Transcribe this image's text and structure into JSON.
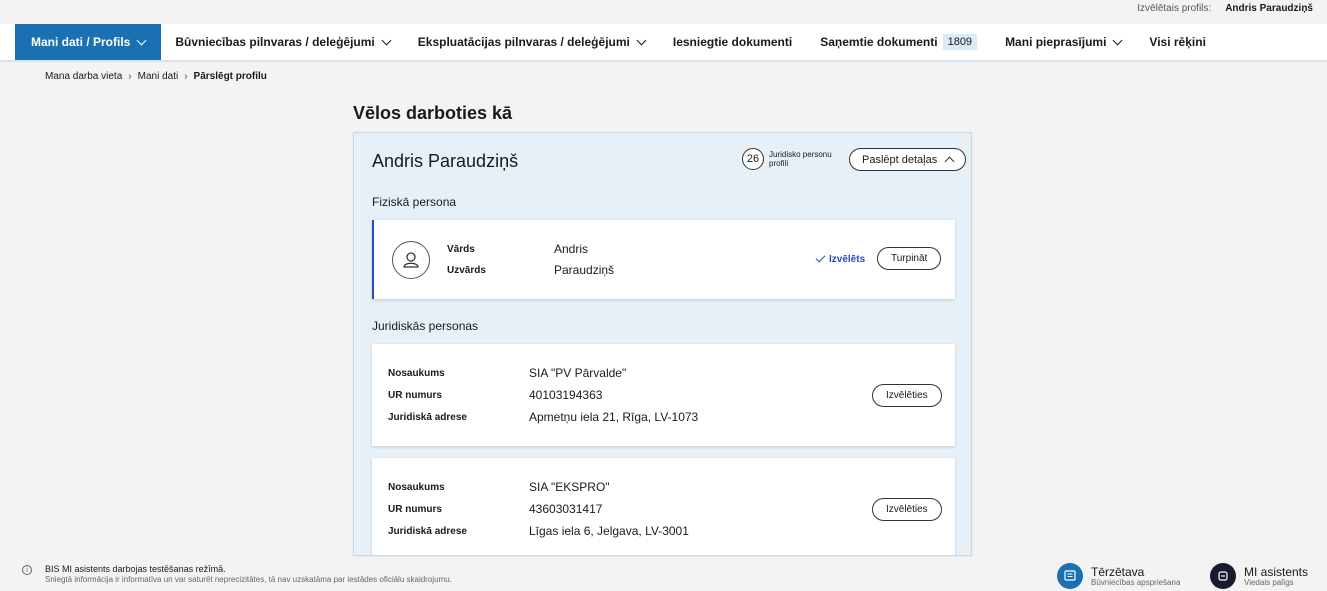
{
  "topbar": {
    "profile_label": "Izvēlētais profils:",
    "profile_name": "Andris Paraudziņš"
  },
  "nav": {
    "items": [
      {
        "label": "Mani dati / Profils",
        "active": true,
        "dropdown": true
      },
      {
        "label": "Būvniecības pilnvaras / deleģējumi",
        "dropdown": true
      },
      {
        "label": "Ekspluatācijas pilnvaras / deleģējumi",
        "dropdown": true
      },
      {
        "label": "Iesniegtie dokumenti"
      },
      {
        "label": "Saņemtie dokumenti",
        "badge": "1809"
      },
      {
        "label": "Mani pieprasījumi",
        "dropdown": true
      },
      {
        "label": "Visi rēķini"
      }
    ]
  },
  "breadcrumb": {
    "items": [
      "Mana darba vieta",
      "Mani dati",
      "Pārslēgt profilu"
    ]
  },
  "page_title": "Vēlos darboties kā",
  "panel": {
    "name": "Andris Paraudziņš",
    "count": "26",
    "count_label": "Juridisko personu profili",
    "hide_label": "Paslēpt detaļas",
    "physical_label": "Fiziskā persona",
    "person": {
      "first_name_label": "Vārds",
      "first_name": "Andris",
      "last_name_label": "Uzvārds",
      "last_name": "Paraudziņš",
      "selected_label": "Izvēlēts",
      "continue_label": "Turpināt"
    },
    "legal_label": "Juridiskās personas",
    "companies": [
      {
        "name_label": "Nosaukums",
        "name": "SIA \"PV Pārvalde\"",
        "reg_label": "UR numurs",
        "reg": "40103194363",
        "addr_label": "Juridiskā adrese",
        "addr": "Apmetņu iela 21, Rīga, LV-1073",
        "select_label": "Izvēlēties"
      },
      {
        "name_label": "Nosaukums",
        "name": "SIA \"EKSPRO\"",
        "reg_label": "UR numurs",
        "reg": "43603031417",
        "addr_label": "Juridiskā adrese",
        "addr": "Līgas iela 6, Jelgava, LV-3001",
        "select_label": "Izvēlēties"
      }
    ]
  },
  "footer": {
    "info_line1": "BIS MI asistents darbojas testēšanas režīmā.",
    "info_line2": "Sniegtā informācija ir informatīva un var saturēt neprecizitātes, tā nav uzskatāma par iestādes oficiālu skaidrojumu.",
    "chat": {
      "title": "Tērzētava",
      "subtitle": "Būvniecības apspriešana",
      "color": "#1a70b1"
    },
    "ai": {
      "title": "MI asistents",
      "subtitle": "Viedais palīgs",
      "color": "#1a1a2e"
    }
  },
  "colors": {
    "accent": "#1a70b1",
    "selected": "#3148c4"
  }
}
